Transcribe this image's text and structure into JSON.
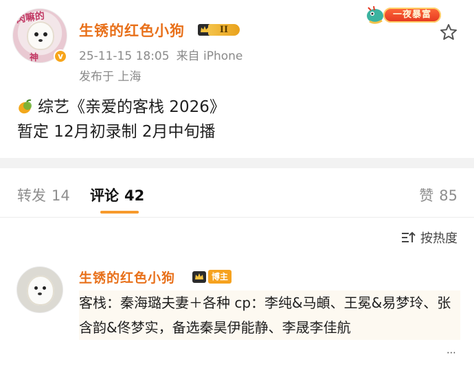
{
  "post": {
    "avatar_caption_top": "肉嘛的",
    "avatar_caption_bottom": "神",
    "verified_mark": "v",
    "username": "生锈的红色小狗",
    "level": "II",
    "date": "25-11-15 18:05",
    "source": "来自 iPhone",
    "location": "发布于 上海",
    "promo_label": "一夜暴富",
    "content_line1": "综艺《亲爱的客栈 2026》",
    "content_line2": "暂定 12月初录制 2月中旬播",
    "icons": {
      "star": "star-icon",
      "mango": "mango-icon",
      "crown": "crown-icon",
      "promo": "dragon-icon"
    }
  },
  "tabs": {
    "repost_label": "转发",
    "repost_count": "14",
    "comment_label": "评论",
    "comment_count": "42",
    "like_label": "赞",
    "like_count": "85"
  },
  "sort": {
    "label": "按热度",
    "icon": "sort-icon"
  },
  "comment": {
    "username": "生锈的红色小狗",
    "host_badge": "博主",
    "text": "客栈：秦海璐夫妻＋各种 cp：李纯&马頔、王冕&易梦玲、张含韵&佟梦实，备选秦昊伊能静、李晟李佳航"
  },
  "colors": {
    "username": "#e8701a",
    "accent_underline": "#f79a2c",
    "muted": "#8a8a8a",
    "band": "#f2f2f2"
  }
}
